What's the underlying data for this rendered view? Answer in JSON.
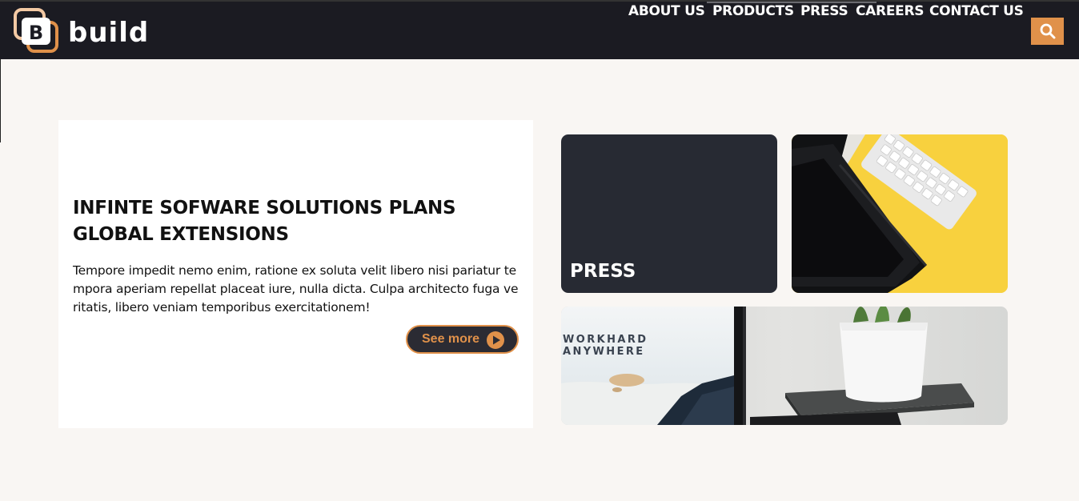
{
  "brand": {
    "logo_letter": "B",
    "name": "build"
  },
  "nav": {
    "items": [
      "ABOUT US",
      "PRODUCTS",
      "PRESS",
      "CAREERS",
      "CONTACT US"
    ]
  },
  "search": {
    "icon": "search-icon"
  },
  "feature": {
    "title": "INFINTE SOFWARE SOLUTIONS PLANS GLOBAL EXTENSIONS",
    "body": "Tempore impedit nemo enim, ratione ex soluta velit libero nisi pariatur tempora aperiam repellat placeat iure, nulla dicta. Culpa architecto fuga veritatis, libero veniam temporibus exercitationem!",
    "button_label": "See more",
    "button_icon": "play-circle-icon"
  },
  "tiles": {
    "press_label": "PRESS",
    "poster_line1": "WORKHARD",
    "poster_line2": "ANYWHERE"
  },
  "colors": {
    "header_bg": "#1b1b22",
    "accent": "#e0914a",
    "page_bg": "#f9f6f3",
    "press_tile": "#272a33",
    "yellow_tile": "#f8d13e"
  }
}
